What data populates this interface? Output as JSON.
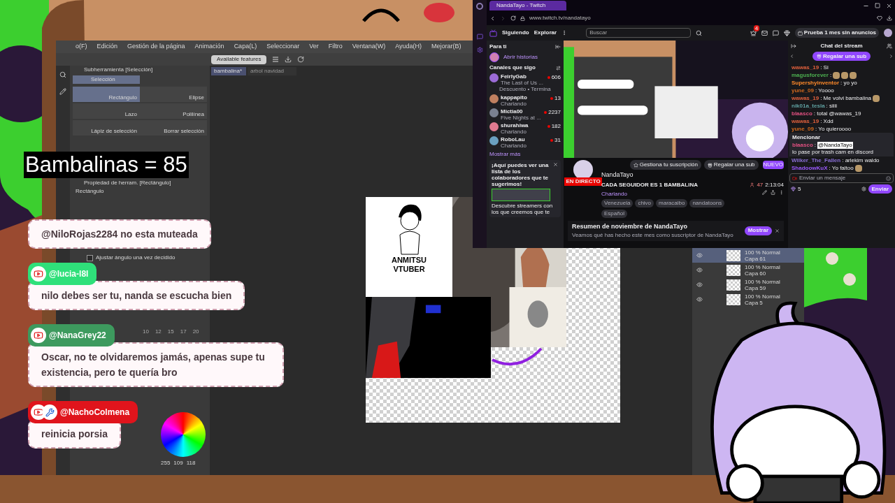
{
  "counter": "Bambalinas = 85",
  "paint_app": {
    "menu": [
      "o(F)",
      "Edición",
      "Gestión de la página",
      "Animación",
      "Capa(L)",
      "Seleccionar",
      "Ver",
      "Filtro",
      "Ventana(W)",
      "Ayuda(H)",
      "Mejorar(B)"
    ],
    "features_badge": "Available features",
    "doc_tabs": [
      {
        "label": "bambalina*",
        "selected": true
      },
      {
        "label": "arbol navidad",
        "selected": false
      }
    ],
    "subtool_panel": {
      "title": "Subherramienta [Selección]",
      "group": "Selección",
      "tools": [
        {
          "label": "Rectángulo",
          "selected": true
        },
        {
          "label": "Elipse",
          "selected": false
        },
        {
          "label": "Lazo",
          "selected": false
        },
        {
          "label": "Polilínea",
          "selected": false
        },
        {
          "label": "Lápiz de selección",
          "selected": false
        },
        {
          "label": "Borrar selección",
          "selected": false
        }
      ]
    },
    "property_panel": {
      "title": "Propiedad de herram. [Rectángulo]",
      "tool": "Rectángulo",
      "option": {
        "label": "Ajustar ángulo una vez decidido",
        "checked": false
      },
      "sizes": [
        "10",
        "12",
        "15",
        "17",
        "20"
      ]
    },
    "color_values": [
      "255",
      "109",
      "118"
    ],
    "sticker": [
      "ANMITSU",
      "VTUBER"
    ],
    "layers": [
      {
        "blend": "100 % Normal",
        "name": "Capa 61",
        "selected": true
      },
      {
        "blend": "100 % Normal",
        "name": "Capa 60",
        "selected": false
      },
      {
        "blend": "100 % Normal",
        "name": "Capa 59",
        "selected": false
      },
      {
        "blend": "100 % Normal",
        "name": "Capa 5",
        "selected": false
      }
    ]
  },
  "overlay_chat": [
    {
      "text": "@NiloRojas2284 no esta muteada"
    },
    {
      "author": "@lucia-l8l",
      "color": "#2fe07a",
      "moderator": false,
      "text": "nilo debes ser tu, nanda se escucha bien"
    },
    {
      "author": "@NanaGrey22",
      "color": "#3d9a5e",
      "moderator": false,
      "text": "Oscar, no te olvidaremos jamás, apenas supe tu existencia, pero te quería bro"
    },
    {
      "author": "@NachoColmena",
      "color": "#e0141c",
      "moderator": true,
      "text": "reinicia porsia"
    }
  ],
  "browser": {
    "tab": "NandaTayo - Twitch",
    "url": "www.twitch.tv/nandatayo",
    "twitch": {
      "nav": [
        "Siguiendo",
        "Explorar"
      ],
      "search": {
        "placeholder": "Buscar"
      },
      "notifications": "4",
      "prime_button": "Prueba 1 mes sin anuncios",
      "sidebar": {
        "title": "Para ti",
        "stories": "Abrir historias",
        "section": "Canales que sigo",
        "channels": [
          {
            "name": "FeirlyGab",
            "activity": "The Last of Us ...",
            "note": "Descuento • Termina",
            "viewers": "606",
            "color": "#9b6bd6"
          },
          {
            "name": "kappapito",
            "activity": "Charlando",
            "viewers": "13",
            "color": "#c08060"
          },
          {
            "name": "Mictia00",
            "activity": "Five Nights at ...",
            "viewers": "2237",
            "color": "#7a8090"
          },
          {
            "name": "shurahiwa",
            "activity": "Charlando",
            "viewers": "182",
            "color": "#e07a90"
          },
          {
            "name": "RoboLau",
            "activity": "Charlando",
            "viewers": "31",
            "color": "#6aa0c0"
          }
        ],
        "more": "Mostrar más",
        "promo": {
          "title": "¡Aquí puedes ver una lista de los colaboradores que te sugerimos!",
          "text": "Descubre streamers con los que creemos que te"
        }
      },
      "channel": {
        "name": "NandaTayo",
        "live": "EN DIRECTO",
        "title": "CADA SEGUIDOR ES 1 BAMBALINA",
        "category": "Charlando",
        "tags": [
          "Venezuela",
          "chivo",
          "maracaibo",
          "nandatoons",
          "Español"
        ],
        "viewers": "47",
        "uptime": "2:13:04",
        "manage": "Gestiona tu suscripción",
        "gift": "Regalar una sub",
        "new_badge": "NUEVO"
      },
      "recap": {
        "title": "Resumen de noviembre de NandaTayo",
        "text": "Veamos qué has hecho este mes como suscriptor de NandaTayo",
        "button": "Mostrar"
      },
      "chat": {
        "title": "Chat del stream",
        "gift": "Regalar una sub",
        "messages": [
          {
            "user": "wawas_19",
            "color": "#e0603c",
            "text": ": Si"
          },
          {
            "user": "magusforever",
            "color": "#4caf50",
            "text": ":",
            "emotes": [
              {
                "kind": "emote"
              },
              {
                "kind": "emote"
              },
              {
                "kind": "emote"
              }
            ]
          },
          {
            "user": "Supershyinventor",
            "color": "#ff8a2a",
            "text": ": yo yo"
          },
          {
            "user": "yune_09",
            "color": "#d2691e",
            "text": ": Yoooo"
          },
          {
            "user": "wawas_19",
            "color": "#e0603c",
            "text": ": Me volvi bambalina",
            "emotes": [
              {
                "kind": "emote"
              }
            ]
          },
          {
            "user": "nik01a_tesla",
            "color": "#5fa0a0",
            "text": ": siiii"
          },
          {
            "user": "blaasco",
            "color": "#e05080",
            "text": ": total @wawas_19"
          },
          {
            "user": "wawas_19",
            "color": "#e0603c",
            "text": ": Xdd"
          },
          {
            "user": "yune_09",
            "color": "#d2691e",
            "text": ": Yo quieroooo"
          }
        ],
        "mention": {
          "title": "Mencionar",
          "user": "blaasco",
          "color": "#e05080",
          "separator": ":",
          "tag": "@NandaTayo",
          "text": "lo pase por trash cam en discord"
        },
        "after": [
          {
            "user": "Wilker_The_Fallen",
            "color": "#8a6fd6",
            "text": ": arlekim waldo"
          },
          {
            "user": "ShadoowKuX",
            "color": "#9b59ff",
            "text": ": Yo faltoo",
            "emotes": [
              {
                "kind": "emote"
              }
            ]
          }
        ],
        "input": {
          "placeholder": "Enviar un mensaje"
        },
        "points": "5",
        "send": "Enviar"
      }
    }
  }
}
